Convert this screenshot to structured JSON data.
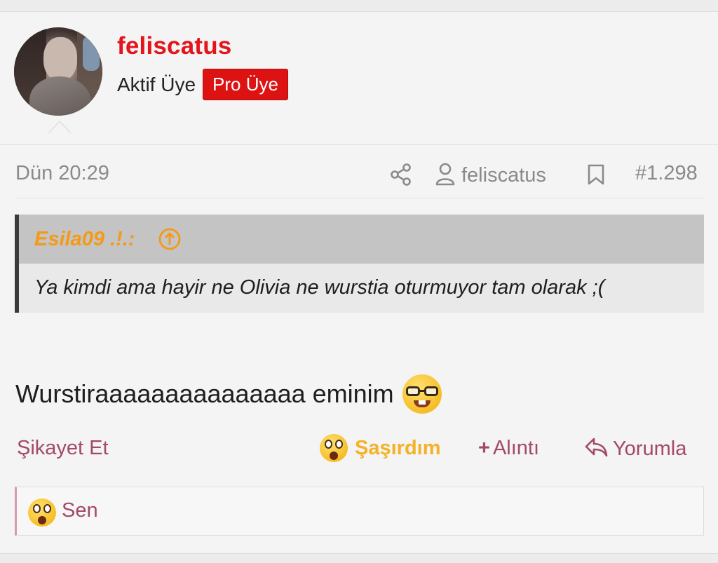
{
  "user": {
    "username": "feliscatus",
    "title": "Aktif Üye",
    "badge": "Pro Üye",
    "avatar": "avatar-image"
  },
  "meta": {
    "date": "Dün 20:29",
    "author": "feliscatus",
    "post_number": "#1.298",
    "icons": [
      "share-icon",
      "user-icon",
      "bookmark-icon"
    ]
  },
  "quote": {
    "author": "Esila09 .!.:",
    "text": "Ya kimdi ama hayir ne Olivia ne wurstia oturmuyor tam olarak ;(",
    "icon": "arrow-up-circle-icon"
  },
  "message": {
    "text": "Wurstiraaaaaaaaaaaaaaa eminim",
    "emoji": "nerd-face-emoji"
  },
  "actions": {
    "report": "Şikayet Et",
    "reaction": "Şaşırdım",
    "quote": "Alıntı",
    "reply": "Yorumla"
  },
  "reactions_summary": {
    "label": "Sen",
    "emoji": "astonished-face-emoji"
  },
  "colors": {
    "username": "#e3141b",
    "badge_bg": "#dd1313",
    "quote_author": "#f39a17",
    "action_link": "#a3496a",
    "reaction_active": "#f3b227",
    "meta_text": "#8a8a8a"
  }
}
